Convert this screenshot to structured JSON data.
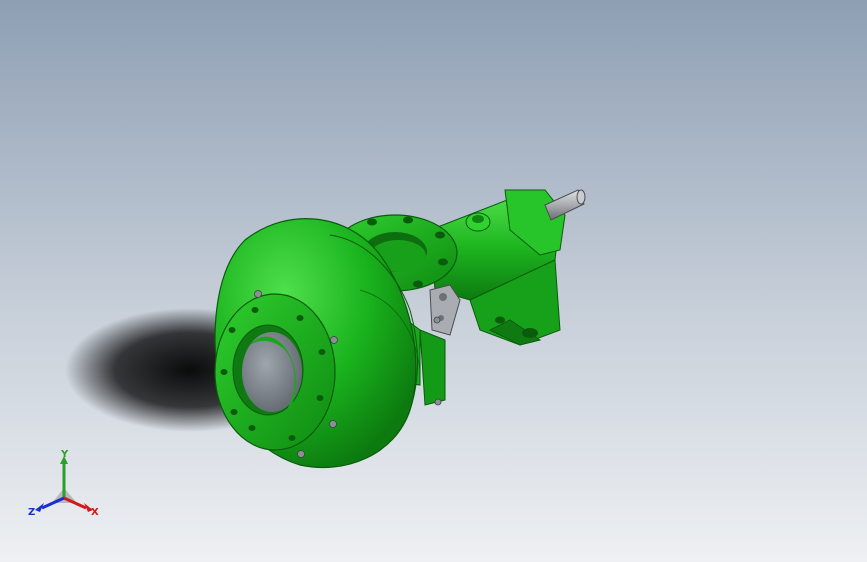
{
  "viewport": {
    "colors": {
      "background_top": "#8e9fb4",
      "background_bottom": "#eef0f3",
      "part_green": "#1fb522",
      "part_green_dark": "#0d6e10",
      "part_green_light": "#5fe35b",
      "shaft_gray": "#b9bcc0"
    }
  },
  "triad": {
    "x_label": "X",
    "y_label": "Y",
    "z_label": "Z",
    "x_color": "#d21a1a",
    "y_color": "#2aa02a",
    "z_color": "#1a2fd2"
  }
}
